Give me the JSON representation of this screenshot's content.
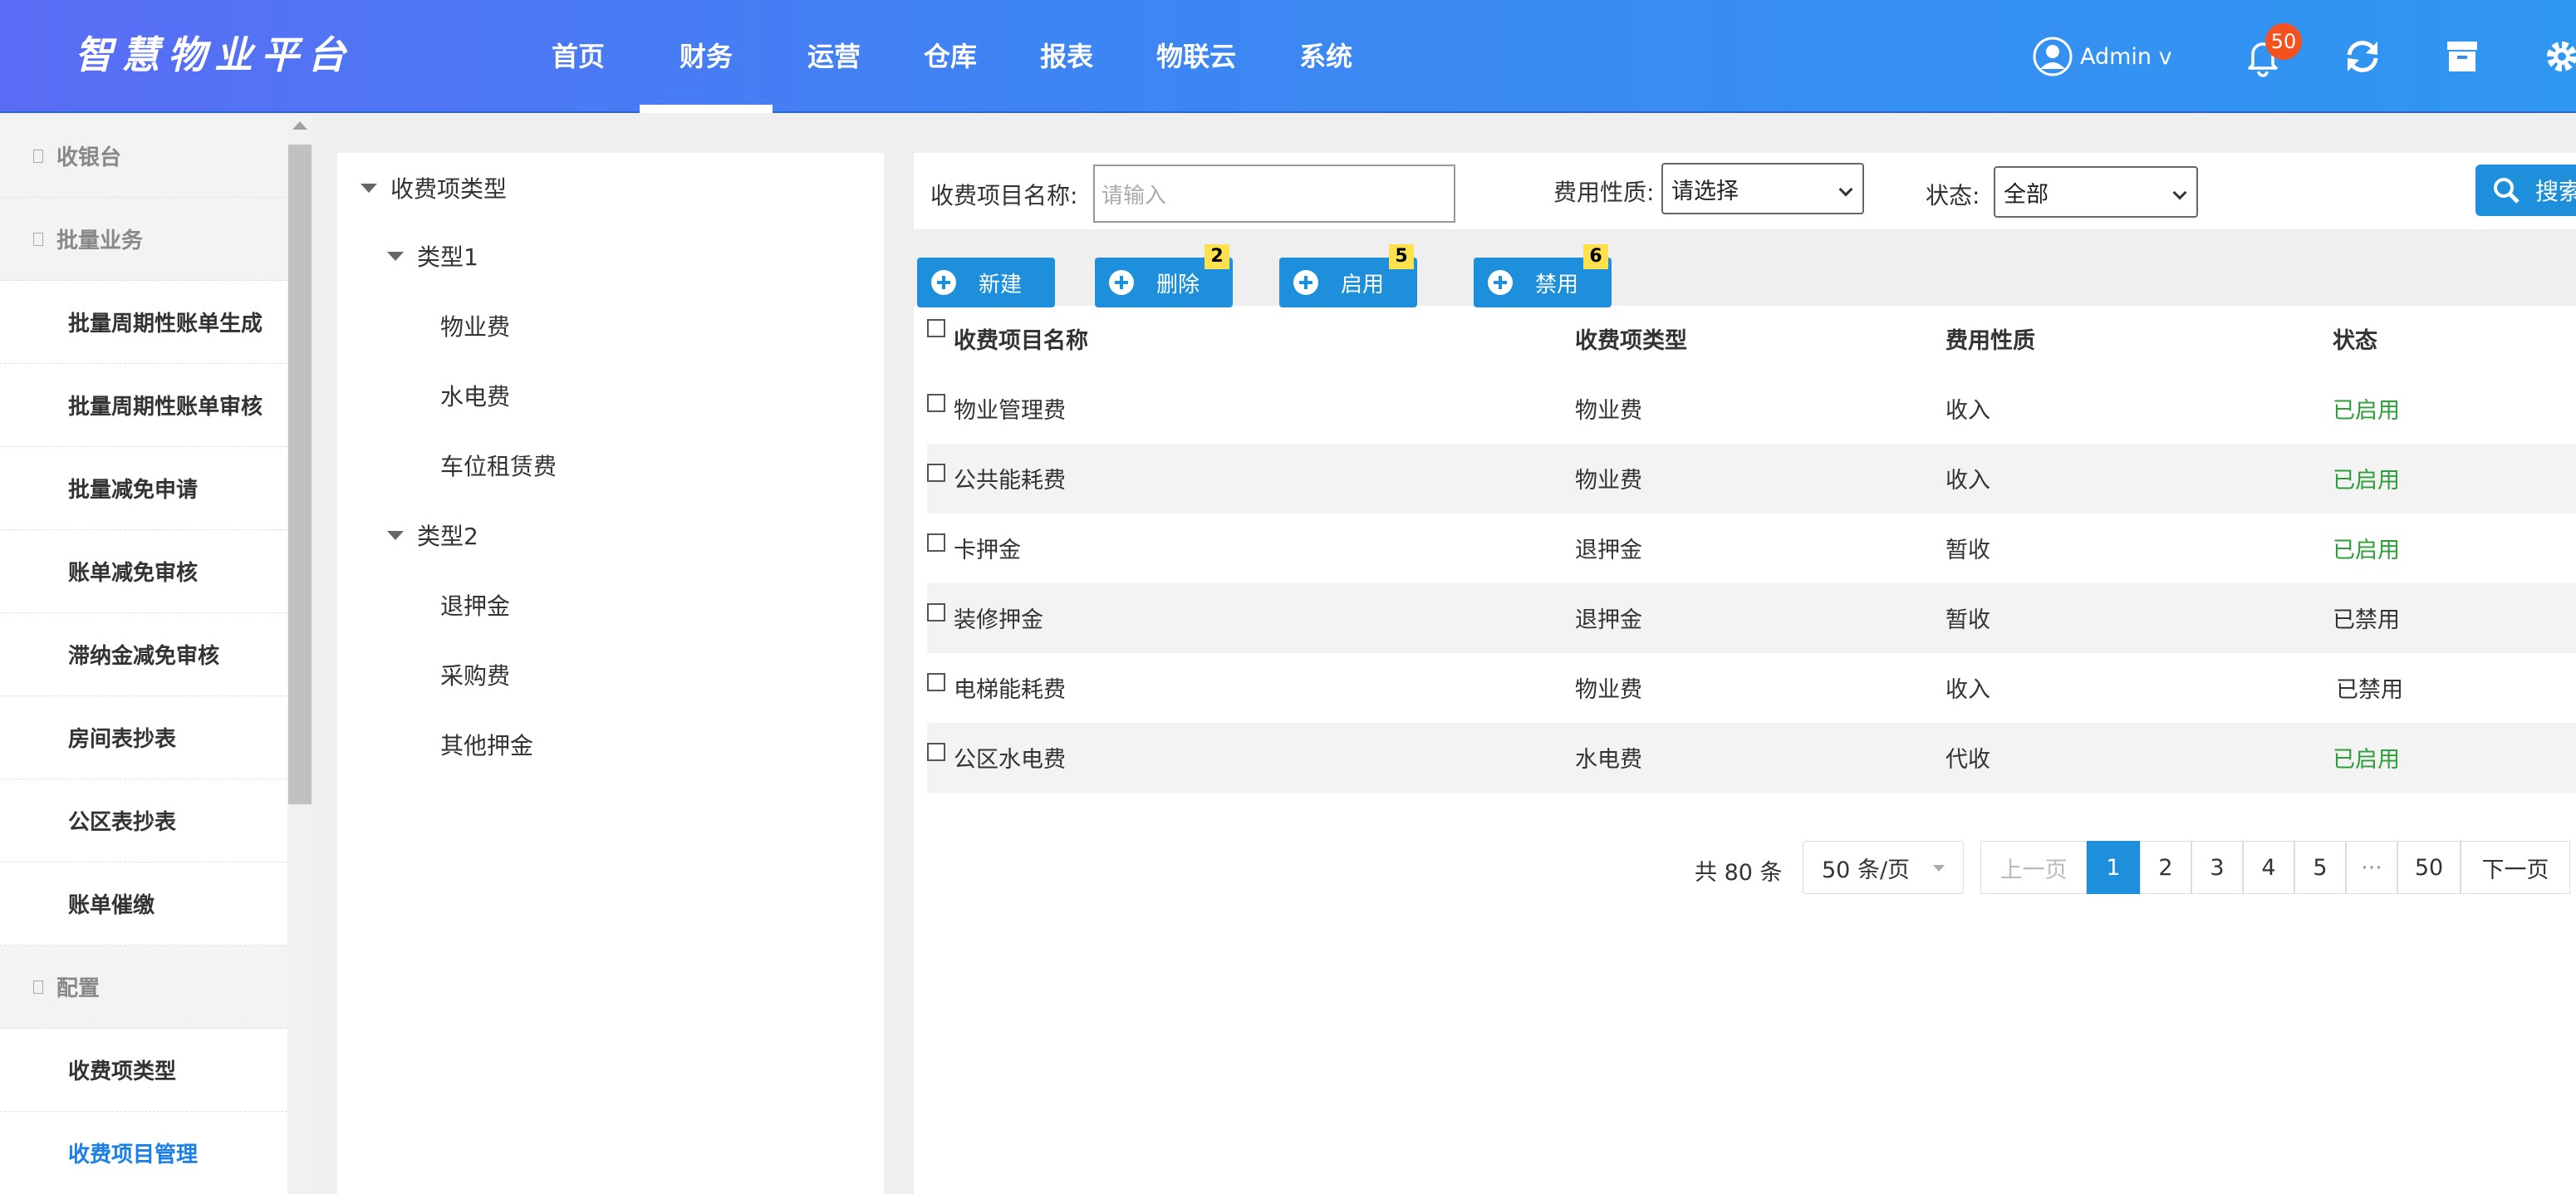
{
  "header": {
    "logo": "智慧物业平台",
    "nav": [
      "首页",
      "财务",
      "运营",
      "仓库",
      "报表",
      "物联云",
      "系统"
    ],
    "active_nav": "财务",
    "user": "Admin v",
    "notification_count": "50"
  },
  "sidebar": {
    "items": [
      {
        "label": "收银台",
        "type": "group"
      },
      {
        "label": "批量业务",
        "type": "group"
      },
      {
        "label": "批量周期性账单生成",
        "type": "item"
      },
      {
        "label": "批量周期性账单审核",
        "type": "item"
      },
      {
        "label": "批量减免申请",
        "type": "item"
      },
      {
        "label": "账单减免审核",
        "type": "item"
      },
      {
        "label": "滞纳金减免审核",
        "type": "item"
      },
      {
        "label": "房间表抄表",
        "type": "item"
      },
      {
        "label": "公区表抄表",
        "type": "item"
      },
      {
        "label": "账单催缴",
        "type": "item"
      },
      {
        "label": "配置",
        "type": "group"
      },
      {
        "label": "收费项类型",
        "type": "item"
      },
      {
        "label": "收费项目管理",
        "type": "item",
        "active": true
      }
    ]
  },
  "tree": {
    "root": "收费项类型",
    "type1": "类型1",
    "type1_children": [
      "物业费",
      "水电费",
      "车位租赁费"
    ],
    "type2": "类型2",
    "type2_children": [
      "退押金",
      "采购费",
      "其他押金"
    ]
  },
  "filters": {
    "name_label": "收费项目名称:",
    "name_placeholder": "请输入",
    "nature_label": "费用性质:",
    "nature_value": "请选择",
    "status_label": "状态:",
    "status_value": "全部",
    "search_label": "搜索"
  },
  "actions": [
    {
      "label": "新建",
      "badge": ""
    },
    {
      "label": "删除",
      "badge": "2"
    },
    {
      "label": "启用",
      "badge": "5"
    },
    {
      "label": "禁用",
      "badge": "6"
    }
  ],
  "table": {
    "columns": [
      "收费项目名称",
      "收费项类型",
      "费用性质",
      "状态"
    ],
    "rows": [
      [
        "物业管理费",
        "物业费",
        "收入",
        "已启用"
      ],
      [
        "公共能耗费",
        "物业费",
        "收入",
        "已启用"
      ],
      [
        "卡押金",
        "退押金",
        "暂收",
        "已启用"
      ],
      [
        "装修押金",
        "退押金",
        "暂收",
        "已禁用"
      ],
      [
        "电梯能耗费",
        "物业费",
        "收入",
        "已禁用"
      ],
      [
        "公区水电费",
        "水电费",
        "代收",
        "已启用"
      ]
    ]
  },
  "pagination": {
    "total": "共 80 条",
    "page_size": "50 条/页",
    "prev": "上一页",
    "pages": [
      "1",
      "2",
      "3",
      "4",
      "5",
      "···",
      "50"
    ],
    "current": "1",
    "next": "下一页"
  },
  "colors": {
    "accent": "#1d8fdb",
    "enabled": "#2e9e3a",
    "badge": "#f4511e"
  }
}
